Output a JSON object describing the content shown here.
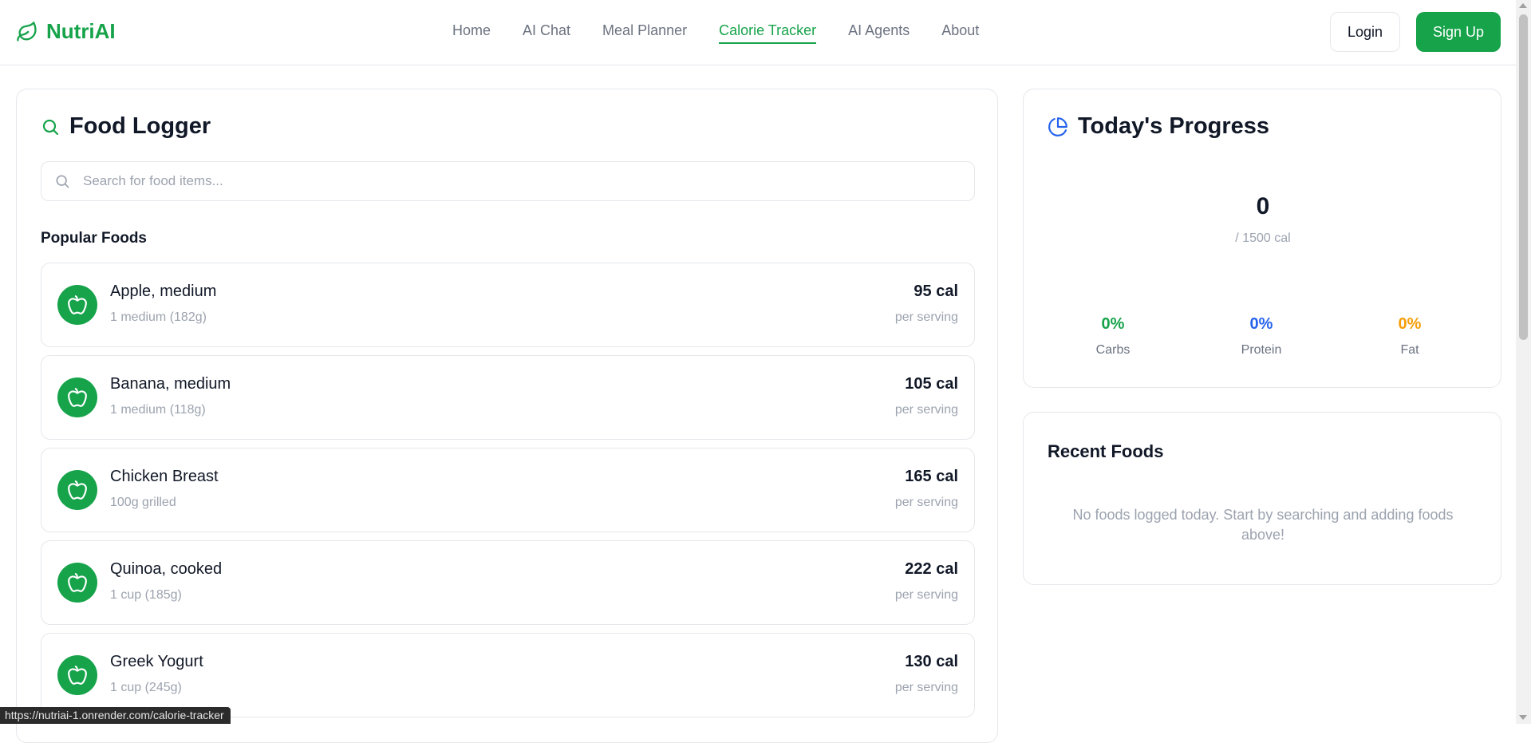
{
  "app": {
    "name": "NutriAI",
    "brand_color": "#16a34a",
    "logo_icon": "leaf-icon"
  },
  "nav": {
    "items": [
      {
        "label": "Home",
        "active": false
      },
      {
        "label": "AI Chat",
        "active": false
      },
      {
        "label": "Meal Planner",
        "active": false
      },
      {
        "label": "Calorie Tracker",
        "active": true
      },
      {
        "label": "AI Agents",
        "active": false
      },
      {
        "label": "About",
        "active": false
      }
    ],
    "login_label": "Login",
    "signup_label": "Sign Up"
  },
  "food_logger": {
    "title": "Food Logger",
    "title_icon": "search-icon",
    "search": {
      "placeholder": "Search for food items...",
      "value": ""
    },
    "popular_label": "Popular Foods",
    "items": [
      {
        "name": "Apple, medium",
        "serving": "1 medium (182g)",
        "calories": "95 cal",
        "per": "per serving",
        "icon": "apple-icon"
      },
      {
        "name": "Banana, medium",
        "serving": "1 medium (118g)",
        "calories": "105 cal",
        "per": "per serving",
        "icon": "apple-icon"
      },
      {
        "name": "Chicken Breast",
        "serving": "100g grilled",
        "calories": "165 cal",
        "per": "per serving",
        "icon": "apple-icon"
      },
      {
        "name": "Quinoa, cooked",
        "serving": "1 cup (185g)",
        "calories": "222 cal",
        "per": "per serving",
        "icon": "apple-icon"
      },
      {
        "name": "Greek Yogurt",
        "serving": "1 cup (245g)",
        "calories": "130 cal",
        "per": "per serving",
        "icon": "apple-icon"
      }
    ]
  },
  "progress": {
    "title": "Today's Progress",
    "title_icon": "pie-chart-icon",
    "calories_value": "0",
    "calories_goal": "/ 1500 cal",
    "macros": {
      "carbs": {
        "value": "0%",
        "label": "Carbs",
        "color": "#16a34a"
      },
      "protein": {
        "value": "0%",
        "label": "Protein",
        "color": "#2563eb"
      },
      "fat": {
        "value": "0%",
        "label": "Fat",
        "color": "#f59e0b"
      }
    }
  },
  "recent": {
    "title": "Recent Foods",
    "empty_text": "No foods logged today. Start by searching and adding foods above!"
  },
  "status_bar": {
    "url": "https://nutriai-1.onrender.com/calorie-tracker"
  }
}
